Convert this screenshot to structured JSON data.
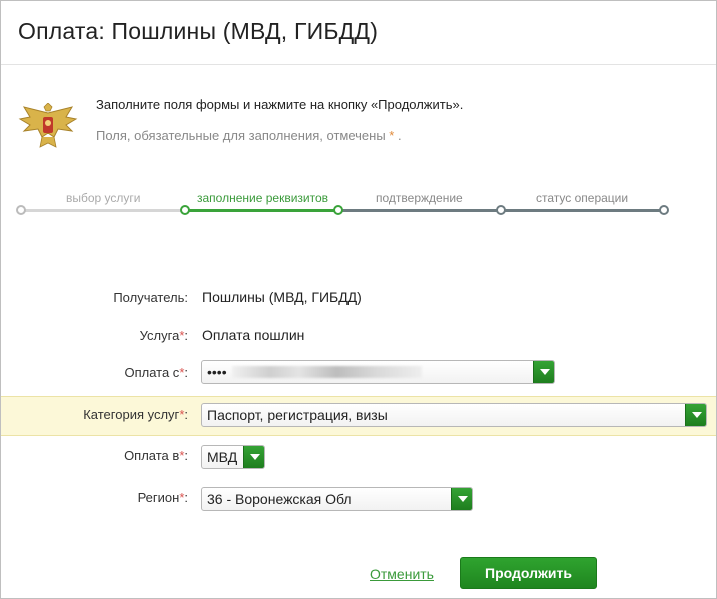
{
  "header": {
    "title": "Оплата: Пошлины (МВД, ГИБДД)"
  },
  "info": {
    "main": "Заполните поля формы и нажмите на кнопку «Продолжить».",
    "sub": "Поля, обязательные для заполнения, отмечены",
    "star": "*",
    "sub_end": "."
  },
  "steps": [
    {
      "label": "выбор услуги",
      "state": "done"
    },
    {
      "label": "заполнение реквизитов",
      "state": "active"
    },
    {
      "label": "подтверждение",
      "state": "pending"
    },
    {
      "label": "статус операции",
      "state": "pending"
    }
  ],
  "form": {
    "recipient": {
      "label": "Получатель:",
      "value": "Пошлины (МВД, ГИБДД)"
    },
    "service": {
      "label": "Услуга",
      "req": "*",
      "colon": ":",
      "value": "Оплата пошлин"
    },
    "pay_from": {
      "label": "Оплата с",
      "req": "*",
      "colon": ":",
      "value": "••••"
    },
    "category": {
      "label": "Категория услуг",
      "req": "*",
      "colon": ":",
      "value": "Паспорт, регистрация, визы"
    },
    "pay_to": {
      "label": "Оплата в",
      "req": "*",
      "colon": ":",
      "value": "МВД"
    },
    "region": {
      "label": "Регион",
      "req": "*",
      "colon": ":",
      "value": "36 - Воронежская Обл"
    }
  },
  "actions": {
    "cancel": "Отменить",
    "continue": "Продолжить"
  },
  "colors": {
    "accent": "#2a9a2a",
    "highlight": "#fcf8d8",
    "required": "#d9534f"
  }
}
